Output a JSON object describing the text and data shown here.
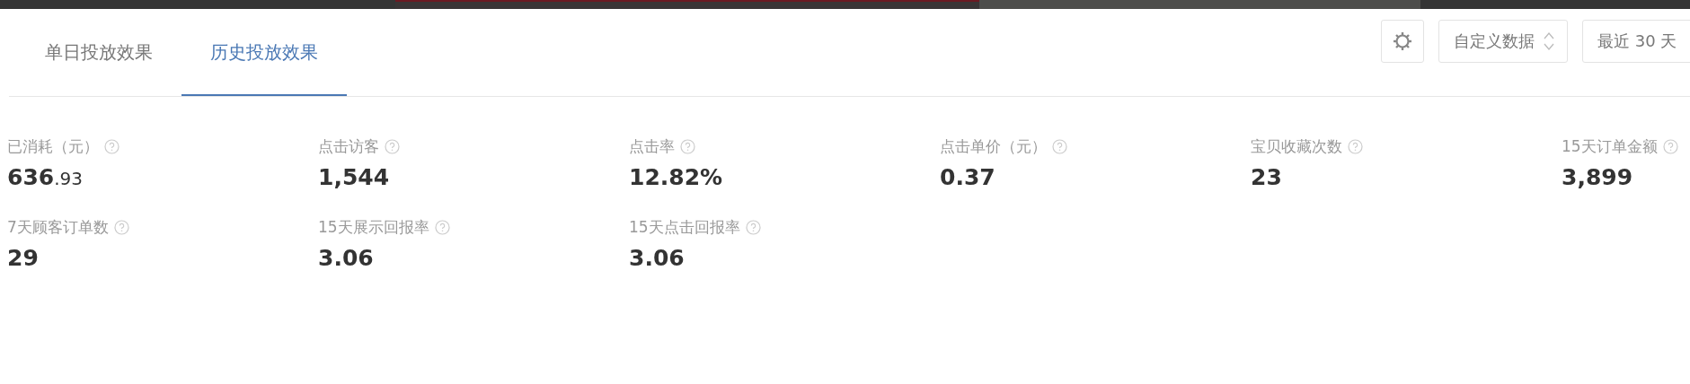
{
  "tabs": [
    {
      "label": "单日投放效果",
      "selected": false
    },
    {
      "label": "历史投放效果",
      "selected": true
    }
  ],
  "toolbar": {
    "custom_data": "自定义数据",
    "date_range": "最近 30 天"
  },
  "metrics": [
    {
      "label": "已消耗（元）",
      "value": "636",
      "decimals": ".93"
    },
    {
      "label": "点击访客",
      "value": "1,544"
    },
    {
      "label": "点击率",
      "value": "12.82%"
    },
    {
      "label": "点击单价（元）",
      "value": "0.37"
    },
    {
      "label": "宝贝收藏次数",
      "value": "23"
    },
    {
      "label": "15天订单金额",
      "value": "3,899"
    },
    {
      "label": "7天顾客订单数",
      "value": "29"
    },
    {
      "label": "15天展示回报率",
      "value": "3.06"
    },
    {
      "label": "15天点击回报率",
      "value": "3.06"
    }
  ]
}
